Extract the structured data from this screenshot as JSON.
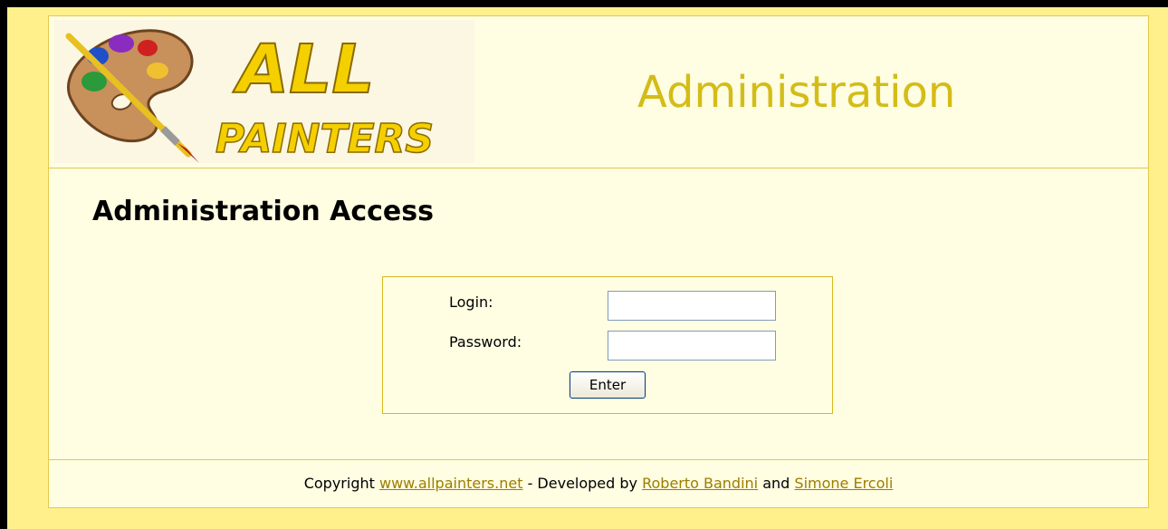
{
  "header": {
    "logo": {
      "text_line1": "ALL",
      "text_line2": "PAINTERS",
      "icon": "paint-palette-with-brush"
    },
    "title": "Administration"
  },
  "main": {
    "title": "Administration Access",
    "login_form": {
      "login_label": "Login:",
      "login_value": "",
      "password_label": "Password:",
      "password_value": "",
      "submit_label": "Enter"
    }
  },
  "footer": {
    "prefix": "Copyright ",
    "site_link": "www.allpainters.net",
    "middle": " - Developed by ",
    "author1_link": "Roberto Bandini",
    "conjunction": " and ",
    "author2_link": "Simone Ercoli"
  },
  "colors": {
    "page_background": "#fff08c",
    "panel_background": "#fffde2",
    "border": "#e6c84a",
    "header_title": "#d4bc18",
    "link": "#9c7e00"
  }
}
